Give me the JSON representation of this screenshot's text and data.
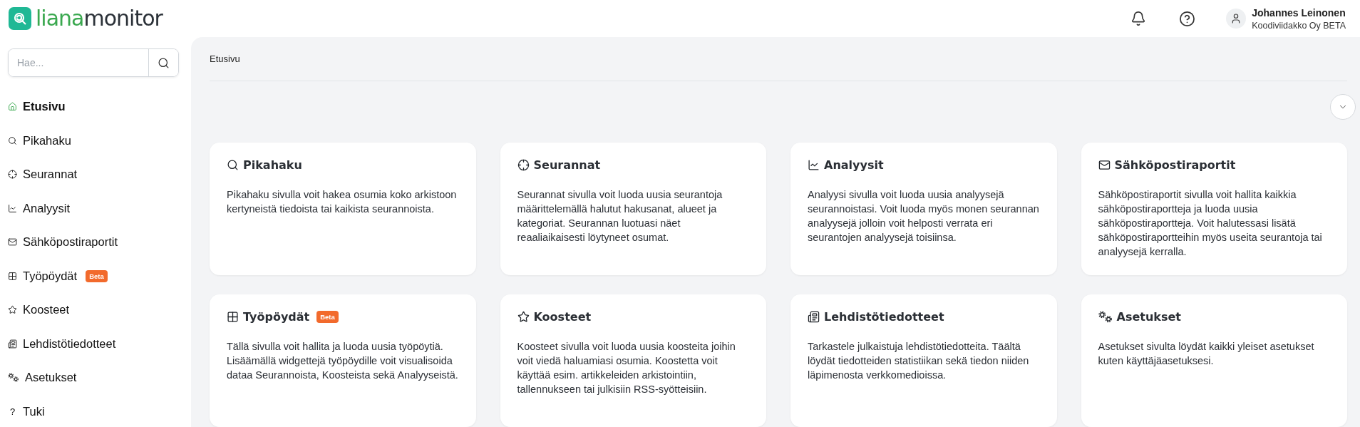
{
  "logo": {
    "first": "liana",
    "second": "monitor"
  },
  "header": {
    "user_name": "Johannes Leinonen",
    "organization": "Koodiviidakko Oy BETA"
  },
  "search": {
    "placeholder": "Hae..."
  },
  "nav": [
    {
      "label": "Etusivu",
      "kind": "home",
      "selected": true
    },
    {
      "label": "Pikahaku",
      "kind": "search",
      "selected": false
    },
    {
      "label": "Seurannat",
      "kind": "crosshair",
      "selected": false
    },
    {
      "label": "Analyysit",
      "kind": "chart",
      "selected": false
    },
    {
      "label": "Sähköpostiraportit",
      "kind": "mail",
      "selected": false
    },
    {
      "label": "Työpöydät",
      "kind": "grid",
      "selected": false,
      "badge": "Beta"
    },
    {
      "label": "Koosteet",
      "kind": "star",
      "selected": false
    },
    {
      "label": "Lehdistötiedotteet",
      "kind": "news",
      "selected": false
    },
    {
      "label": "Asetukset",
      "kind": "gears",
      "selected": false
    },
    {
      "label": "Tuki",
      "glyph": "?",
      "selected": false
    }
  ],
  "breadcrumb": "Etusivu",
  "cards": [
    {
      "title": "Pikahaku",
      "kind": "search",
      "text": "Pikahaku sivulla voit hakea osumia koko arkistoon kertyneistä tiedoista tai kaikista seurannoista."
    },
    {
      "title": "Seurannat",
      "kind": "crosshair",
      "text": "Seurannat sivulla voit luoda uusia seurantoja määrittelemällä halutut hakusanat, alueet ja kategoriat. Seurannan luotuasi näet reaaliaikaisesti löytyneet osumat."
    },
    {
      "title": "Analyysit",
      "kind": "chart",
      "text": "Analyysi sivulla voit luoda uusia analyysejä seurannoistasi. Voit luoda myös monen seurannan analyysejä jolloin voit helposti verrata eri seurantojen analyysejä toisiinsa."
    },
    {
      "title": "Sähköpostiraportit",
      "kind": "mail",
      "text": "Sähköpostiraportit sivulla voit hallita kaikkia sähköpostiraportteja ja luoda uusia sähköpostiraportteja. Voit halutessasi lisätä sähköpostiraportteihin myös useita seurantoja tai analyysejä kerralla."
    },
    {
      "title": "Työpöydät",
      "kind": "grid",
      "badge": "Beta",
      "text": "Tällä sivulla voit hallita ja luoda uusia työpöytiä. Lisäämällä widgettejä työpöydille voit visualisoida dataa Seurannoista, Koosteista sekä Analyyseistä."
    },
    {
      "title": "Koosteet",
      "kind": "star",
      "text": "Koosteet sivulla voit luoda uusia koosteita joihin voit viedä haluamiasi osumia. Koostetta voit käyttää esim. artikkeleiden arkistointiin, tallennukseen tai julkisiin RSS-syötteisiin."
    },
    {
      "title": "Lehdistötiedotteet",
      "kind": "news",
      "text": "Tarkastele julkaistuja lehdistötiedotteita. Täältä löydät tiedotteiden statistiikan sekä tiedon niiden läpimenosta verkkomedioissa."
    },
    {
      "title": "Asetukset",
      "kind": "gears",
      "text": "Asetukset sivulta löydät kaikki yleiset asetukset kuten käyttäjäasetuksesi."
    }
  ]
}
